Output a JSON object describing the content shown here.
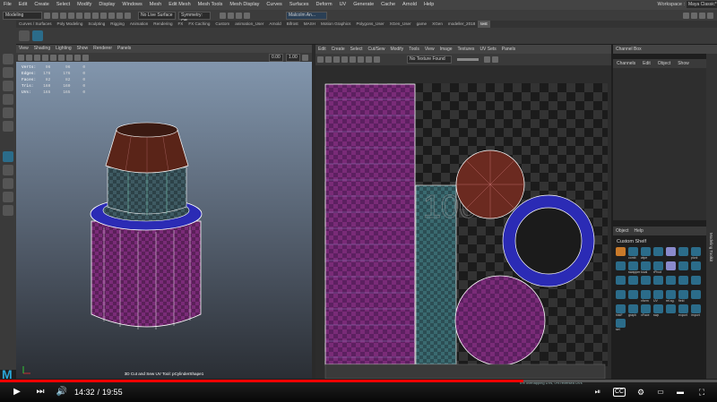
{
  "menubar": {
    "items": [
      "File",
      "Edit",
      "Create",
      "Select",
      "Modify",
      "Display",
      "Windows",
      "Mesh",
      "Edit Mesh",
      "Mesh Tools",
      "Mesh Display",
      "Curves",
      "Surfaces",
      "Deform",
      "UV",
      "Generate",
      "Cache",
      "Arnold",
      "Help"
    ],
    "workspace_label": "Workspace :",
    "workspace_value": "Maya Classic*"
  },
  "statusline": {
    "mode": "Modeling",
    "live_surface": "No Live Surface",
    "symmetry": "Symmetry: Off",
    "user": "Malcolm An..."
  },
  "shelf": {
    "tabs": [
      "Curves / Surfaces",
      "Poly Modeling",
      "Sculpting",
      "Rigging",
      "Animation",
      "Rendering",
      "FX",
      "FX Caching",
      "Custom",
      "animation_User",
      "Arnold",
      "Bifrost",
      "MASH",
      "Motion Graphics",
      "Polygons_User",
      "XGen_User",
      "game",
      "XGen",
      "modeller_2018",
      "test"
    ],
    "active_tab": "test"
  },
  "viewport": {
    "menu": [
      "View",
      "Shading",
      "Lighting",
      "Show",
      "Renderer",
      "Panels"
    ],
    "value_a": "0.00",
    "value_b": "1.00",
    "hud": [
      {
        "label": "Verts:",
        "a": "96",
        "b": "96",
        "c": "0"
      },
      {
        "label": "Edges:",
        "a": "176",
        "b": "176",
        "c": "0"
      },
      {
        "label": "Faces:",
        "a": "82",
        "b": "82",
        "c": "0"
      },
      {
        "label": "Tris:",
        "a": "160",
        "b": "160",
        "c": "0"
      },
      {
        "label": "UVs:",
        "a": "165",
        "b": "165",
        "c": "0"
      }
    ],
    "caption": "3D Cut and Sew UV Tool: pCylinderShape1"
  },
  "uv_editor": {
    "menu": [
      "Edit",
      "Create",
      "Select",
      "Cut/Sew",
      "Modify",
      "Tools",
      "View",
      "Image",
      "Textures",
      "UV Sets",
      "Panels"
    ],
    "texture": "No Texture Found",
    "overlay_label": "1001",
    "status": "0% overlapping UVs, 0% reversed UVs"
  },
  "channel_box": {
    "title": "Channel Box",
    "menu": [
      "Channels",
      "Edit",
      "Object",
      "Show"
    ],
    "side_tab": "Modeling Toolkit"
  },
  "custom_shelf": {
    "menu": [
      "Object",
      "Help"
    ],
    "title": "Custom Shelf",
    "icons": [
      "",
      "comb",
      "wipe",
      "",
      "",
      "",
      "pivot",
      "",
      "swapper",
      "local",
      "rPivot",
      "",
      "",
      "",
      "",
      "",
      "",
      "",
      "",
      "",
      "",
      "",
      "",
      "xform",
      "UV",
      "rel.sg.",
      "field",
      "",
      "histF",
      "graph",
      "xFace",
      "swp",
      "",
      "export",
      "import",
      "sel"
    ]
  },
  "player": {
    "time_current": "14:32",
    "time_total": "19:55",
    "progress": 0.73
  },
  "colors": {
    "accent_red": "#ff0000",
    "uv_purple": "#7a2b78",
    "uv_blue": "#2b2bb5",
    "uv_teal": "#3a7a7a",
    "uv_brown": "#6b2a20",
    "mesh_brown": "#5a2418"
  }
}
